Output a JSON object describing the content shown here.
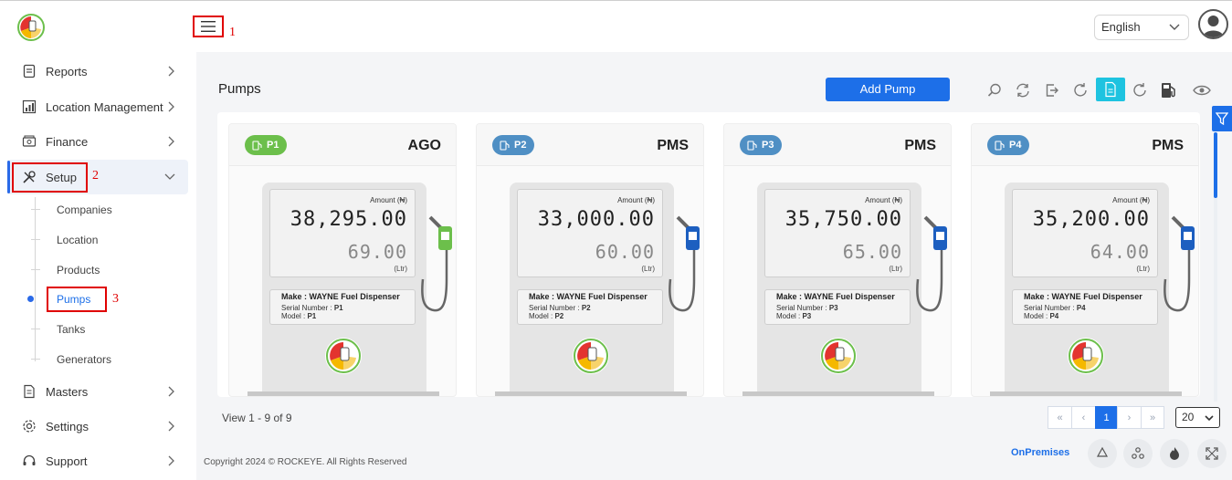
{
  "topbar": {
    "language": "English",
    "annotation_1": "1"
  },
  "sidebar": {
    "items": [
      {
        "label": "Reports",
        "icon": "report-icon"
      },
      {
        "label": "Location Management",
        "icon": "chart-icon"
      },
      {
        "label": "Finance",
        "icon": "finance-icon"
      },
      {
        "label": "Setup",
        "icon": "tools-icon"
      },
      {
        "label": "Masters",
        "icon": "document-icon"
      },
      {
        "label": "Settings",
        "icon": "gear-icon"
      },
      {
        "label": "Support",
        "icon": "headset-icon"
      }
    ],
    "setup_sub": [
      "Companies",
      "Location",
      "Products",
      "Pumps",
      "Tanks",
      "Generators"
    ],
    "annotation_2": "2",
    "annotation_3": "3"
  },
  "main": {
    "title": "Pumps",
    "add_button": "Add Pump",
    "view_count": "View 1 - 9 of 9",
    "current_page": "1",
    "per_page": "20",
    "copyright": "Copyright 2024 © ROCKEYE. All Rights Reserved",
    "mode": "OnPremises"
  },
  "pumps": [
    {
      "badge": "P1",
      "fuel": "AGO",
      "color": "#6cbf4b",
      "amount_label": "Amount (₦)",
      "amount": "38,295.00",
      "litres": "69.00",
      "litres_label": "(Ltr)",
      "make": "Make : WAYNE Fuel Dispenser",
      "serial_label": "Serial Number :",
      "serial": "P1",
      "model_label": "Model :",
      "model": "P1"
    },
    {
      "badge": "P2",
      "fuel": "PMS",
      "color": "#4f8fc4",
      "amount_label": "Amount (₦)",
      "amount": "33,000.00",
      "litres": "60.00",
      "litres_label": "(Ltr)",
      "make": "Make : WAYNE Fuel Dispenser",
      "serial_label": "Serial Number :",
      "serial": "P2",
      "model_label": "Model :",
      "model": "P2"
    },
    {
      "badge": "P3",
      "fuel": "PMS",
      "color": "#4f8fc4",
      "amount_label": "Amount (₦)",
      "amount": "35,750.00",
      "litres": "65.00",
      "litres_label": "(Ltr)",
      "make": "Make : WAYNE Fuel Dispenser",
      "serial_label": "Serial Number :",
      "serial": "P3",
      "model_label": "Model :",
      "model": "P3"
    },
    {
      "badge": "P4",
      "fuel": "PMS",
      "color": "#4f8fc4",
      "amount_label": "Amount (₦)",
      "amount": "35,200.00",
      "litres": "64.00",
      "litres_label": "(Ltr)",
      "make": "Make : WAYNE Fuel Dispenser",
      "serial_label": "Serial Number :",
      "serial": "P4",
      "model_label": "Model :",
      "model": "P4"
    }
  ],
  "colors": {
    "primary": "#1d6fe8",
    "highlight": "#1ec3e0",
    "annotation": "#e00000",
    "ago_green": "#6cbf4b",
    "pms_blue": "#4f8fc4"
  }
}
